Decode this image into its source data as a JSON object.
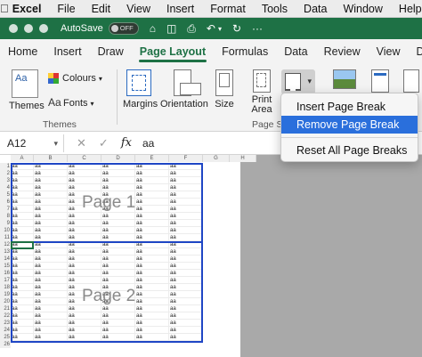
{
  "menubar": {
    "app": "Excel",
    "items": [
      "File",
      "Edit",
      "View",
      "Insert",
      "Format",
      "Tools",
      "Data",
      "Window",
      "Help"
    ]
  },
  "titlebar": {
    "autosave_label": "AutoSave",
    "toggle_label": "OFF"
  },
  "ribbon_tabs": {
    "items": [
      "Home",
      "Insert",
      "Draw",
      "Page Layout",
      "Formulas",
      "Data",
      "Review",
      "View",
      "De"
    ],
    "active": "Page Layout"
  },
  "ribbon": {
    "themes": "Themes",
    "themes_icon_text": "Aa",
    "colours": "Colours",
    "fonts_icon_text": "Aa",
    "fonts": "Fonts",
    "group_themes": "Themes",
    "margins": "Margins",
    "orientation": "Orientation",
    "size": "Size",
    "print_area_1": "Print",
    "print_area_2": "Area",
    "group_page_setup": "Page Se"
  },
  "formula_bar": {
    "name_box": "A12",
    "fx": "fx",
    "value": "aa"
  },
  "sheet": {
    "columns": [
      "A",
      "B",
      "C",
      "D",
      "E",
      "F",
      "G",
      "H"
    ],
    "rows": [
      "1",
      "2",
      "3",
      "4",
      "5",
      "6",
      "7",
      "8",
      "9",
      "10",
      "11",
      "12",
      "13",
      "14",
      "15",
      "16",
      "17",
      "18",
      "19",
      "20",
      "21",
      "22",
      "23",
      "24",
      "25",
      "26"
    ],
    "cell_text": "aa",
    "page1": "Page 1",
    "page2": "Page 2"
  },
  "break_menu": {
    "items": [
      "Insert Page Break",
      "Remove Page Break",
      "Reset All Page Breaks"
    ],
    "highlighted": "Remove Page Break"
  },
  "colors": {
    "excel_green": "#1e7145",
    "page_break_blue": "#1f46c5",
    "menu_highlight": "#2a6fdc"
  }
}
